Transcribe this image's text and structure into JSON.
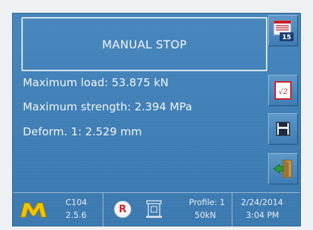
{
  "header": {
    "title": "MANUAL STOP"
  },
  "results": {
    "max_load": "Maximum load: 53.875 kN",
    "max_strength": "Maximum strength: 2.394 MPa",
    "deform": "Deform. 1: 2.529 mm"
  },
  "side_buttons": {
    "calendar_badge": "15",
    "sqrt_label": "√2",
    "icons": [
      "calendar-report-icon",
      "calculator-sqrt-icon",
      "save-disk-icon",
      "exit-door-icon"
    ]
  },
  "status_bar": {
    "logo_letter": "M",
    "model": "C104",
    "version": "2.5.6",
    "r_badge": "R",
    "profile": "Profile: 1",
    "capacity": "50kN",
    "date": "2/24/2014",
    "time": "3:04 PM"
  },
  "colors": {
    "screen_bg": "#3f80b7",
    "text": "#f3f6f9",
    "logo_yellow": "#f2c300",
    "r_red": "#d0262a"
  }
}
